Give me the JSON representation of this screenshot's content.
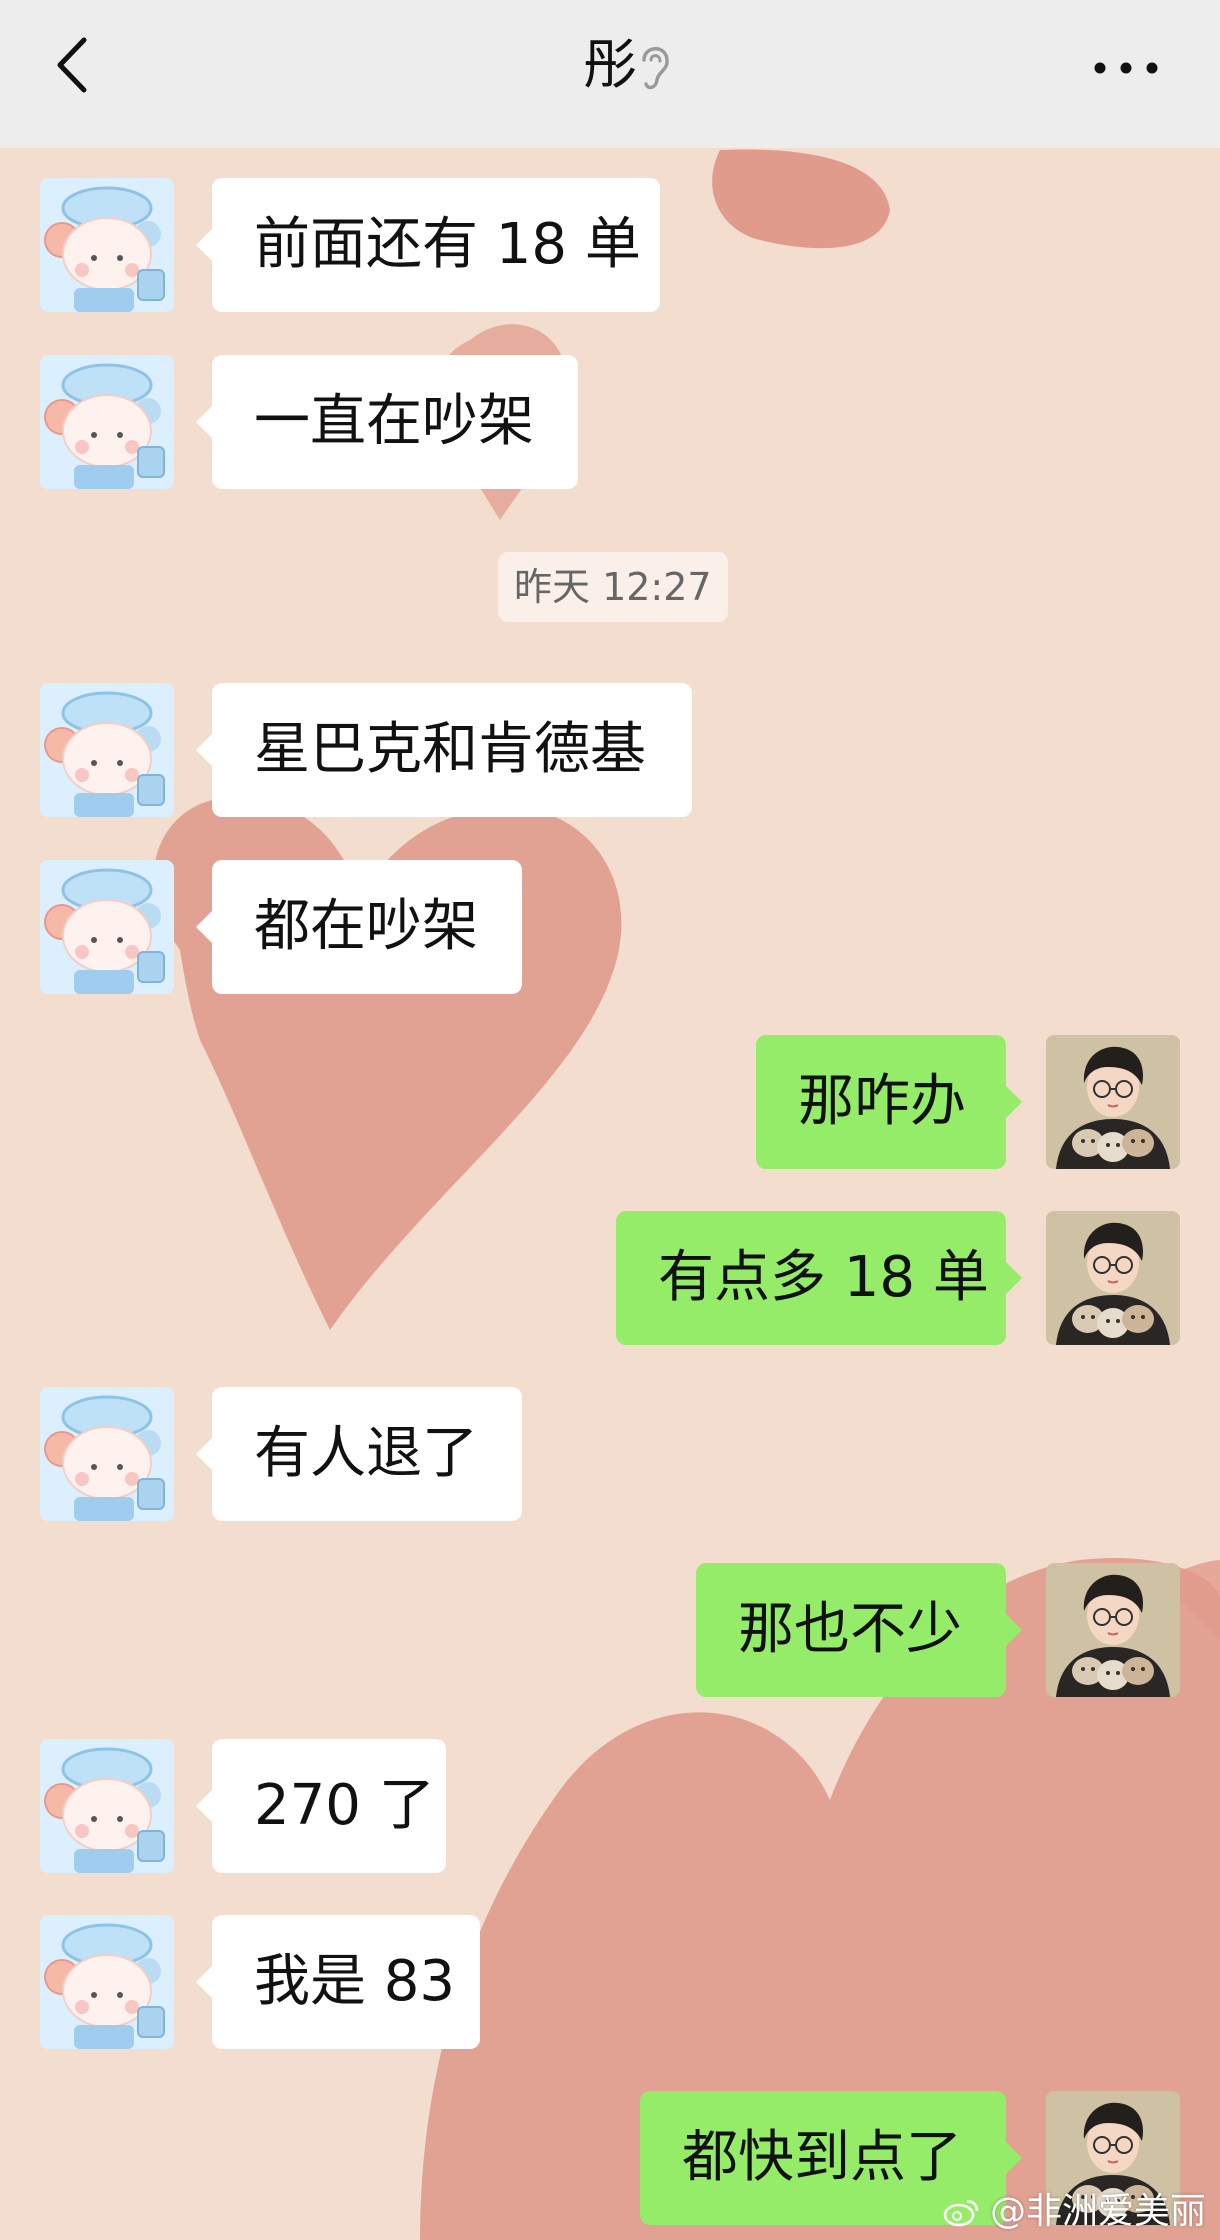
{
  "header": {
    "title": "彤"
  },
  "timestamp": "昨天 12:27",
  "messages": [
    {
      "side": "in",
      "text": "前面还有 18 单"
    },
    {
      "side": "in",
      "text": "一直在吵架"
    },
    {
      "side": "in",
      "text": "星巴克和肯德基"
    },
    {
      "side": "in",
      "text": "都在吵架"
    },
    {
      "side": "out",
      "text": "那咋办"
    },
    {
      "side": "out",
      "text": "有点多 18 单"
    },
    {
      "side": "in",
      "text": "有人退了"
    },
    {
      "side": "out",
      "text": "那也不少"
    },
    {
      "side": "in",
      "text": "270 了"
    },
    {
      "side": "in",
      "text": "我是 83"
    },
    {
      "side": "out",
      "text": "都快到点了"
    }
  ],
  "watermark": "@非洲爱美丽",
  "colors": {
    "outgoing_bubble": "#95ec69",
    "incoming_bubble": "#ffffff",
    "header_bg": "#ededed",
    "wallpaper": "#f3ddcf",
    "wallpaper_hearts": "#dd8f80"
  },
  "icons": {
    "back": "chevron-left-icon",
    "title_status": "ear-icon",
    "more": "more-dots-icon",
    "incoming_avatar": "cartoon-bear-avatar",
    "outgoing_avatar": "girl-with-cats-avatar",
    "watermark_logo": "weibo-icon"
  }
}
